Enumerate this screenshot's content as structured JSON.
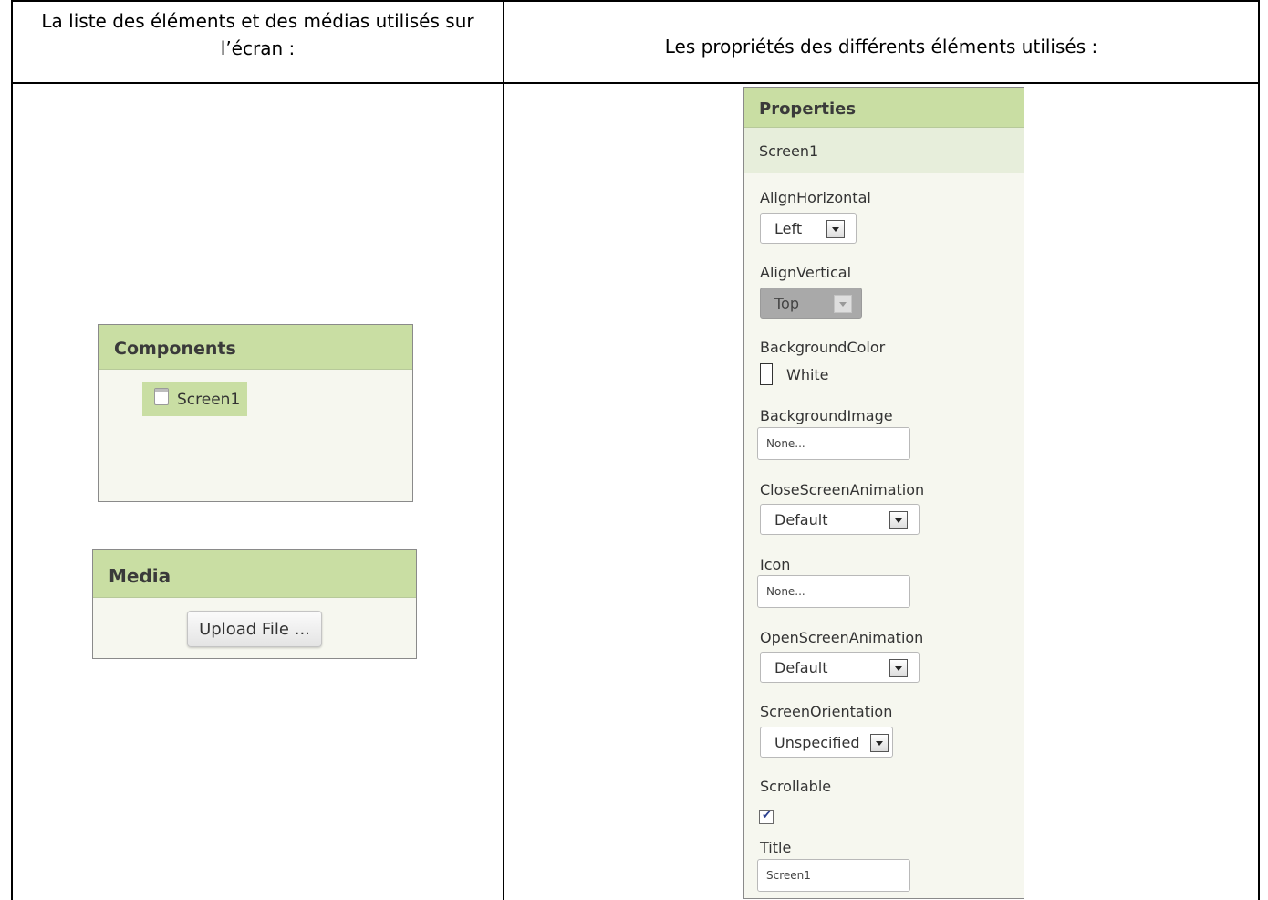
{
  "table": {
    "header_left": "La liste des éléments et des médias utilisés sur l’écran :",
    "header_right": "Les propriétés des différents éléments utilisés :"
  },
  "components": {
    "title": "Components",
    "items": [
      {
        "label": "Screen1",
        "icon": "screen-icon"
      }
    ]
  },
  "media": {
    "title": "Media",
    "upload_label": "Upload File ..."
  },
  "properties": {
    "title": "Properties",
    "selected": "Screen1",
    "align_horizontal": {
      "label": "AlignHorizontal",
      "value": "Left"
    },
    "align_vertical": {
      "label": "AlignVertical",
      "value": "Top",
      "disabled": true
    },
    "background_color": {
      "label": "BackgroundColor",
      "value": "White",
      "color": "#ffffff"
    },
    "background_image": {
      "label": "BackgroundImage",
      "value": "None..."
    },
    "close_screen_animation": {
      "label": "CloseScreenAnimation",
      "value": "Default"
    },
    "icon": {
      "label": "Icon",
      "value": "None..."
    },
    "open_screen_animation": {
      "label": "OpenScreenAnimation",
      "value": "Default"
    },
    "screen_orientation": {
      "label": "ScreenOrientation",
      "value": "Unspecified"
    },
    "scrollable": {
      "label": "Scrollable",
      "checked": true
    },
    "title_prop": {
      "label": "Title",
      "value": "Screen1"
    }
  },
  "colors": {
    "panel_header": "#c9dea3",
    "panel_background": "#f6f7ef",
    "selection": "#c9dea3"
  }
}
